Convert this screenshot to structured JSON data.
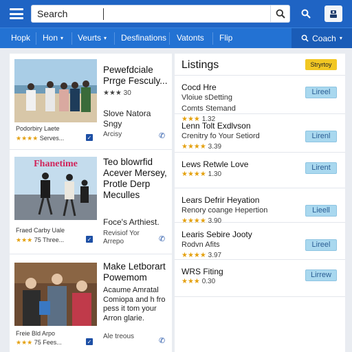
{
  "topbar": {
    "search_placeholder": "Search",
    "icons": [
      "menu-icon",
      "search-icon",
      "filter-icon",
      "user-icon"
    ],
    "colors": {
      "bar": "#1f64c4",
      "nav": "#2372d3"
    }
  },
  "nav": {
    "items": [
      {
        "label": "Hopk",
        "chevron": false
      },
      {
        "label": "Hon",
        "chevron": true
      },
      {
        "label": "Veurts",
        "chevron": true
      },
      {
        "label": "Desfinations",
        "chevron": false
      },
      {
        "label": "Vatonts",
        "chevron": false
      },
      {
        "label": "Flip",
        "chevron": false
      }
    ],
    "right_label": "Coach"
  },
  "cards": [
    {
      "title": "Pewefdciale Prrge Fesculy...",
      "meta": "★★★ 30",
      "sub1": "Slove Natora Sngy",
      "sub2": "Arcisy",
      "caption": "Podorbiry Laete",
      "stars_text": "Serves...",
      "image_title": ""
    },
    {
      "title": "Teo blowrfid Acever Mersey, Protle Derp Meculles",
      "meta": "",
      "sub1": "Foce's Arthiest.",
      "sub2": "Revisiof Yor Arrepo",
      "caption": "Fraed Carby Uale",
      "stars_text": "75 Three...",
      "image_title": "Fhanetime"
    },
    {
      "title": "Make Letborart Powemom",
      "meta": "",
      "sub1": "Acaume Amratal Comiopa and h fro pess it tom your Arron glarie.",
      "sub2": "Ale treous",
      "caption": "Freie Bld Arpo",
      "stars_text": "75 Fees...",
      "image_title": ""
    }
  ],
  "listings": {
    "title": "Listings",
    "badge": "Stryrtoy",
    "items": [
      {
        "title": "Cocd Hre",
        "sub1": "Vloiue sDetting",
        "sub2": "Comts Stemand",
        "rating": "1.32",
        "stars": 3,
        "button": "Lireel"
      },
      {
        "title": "Lenn Tolt Exdlvson",
        "sub1": "Crenitry fo Your Setiord",
        "sub2": "",
        "rating": "3.39",
        "stars": 4,
        "button": "Lirenl"
      },
      {
        "title": "Lews Retwle Love",
        "sub1": "",
        "sub2": "",
        "rating": "1.30",
        "stars": 4,
        "button": "Lirent"
      },
      {
        "title": "Lears Defrir Heyation",
        "sub1": "Renory coange Hepertion",
        "sub2": "",
        "rating": "3.90",
        "stars": 4,
        "button": "Lieell"
      },
      {
        "title": "Learis Sebire Jooty",
        "sub1": "Rodvn Afits",
        "sub2": "",
        "rating": "3.97",
        "stars": 4,
        "button": "Lireel"
      },
      {
        "title": "WRS Fiting",
        "sub1": "",
        "sub2": "",
        "rating": "0.30",
        "stars": 3,
        "button": "Lirrew"
      }
    ]
  }
}
